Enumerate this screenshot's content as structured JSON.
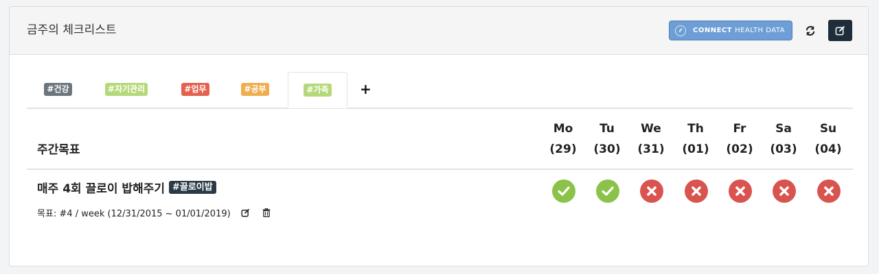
{
  "header": {
    "title": "금주의 체크리스트",
    "connect_bold": "CONNECT",
    "connect_rest": "HEALTH DATA"
  },
  "tabs": [
    {
      "label": "#건강",
      "color": "#6c757d"
    },
    {
      "label": "#자기관리",
      "color": "#b5d97a"
    },
    {
      "label": "#업무",
      "color": "#e4604f"
    },
    {
      "label": "#공부",
      "color": "#f0ad4e"
    },
    {
      "label": "#가족",
      "color": "#b5d97a",
      "active": true
    }
  ],
  "add_tab_label": "+",
  "table": {
    "goal_header": "주간목표",
    "days": [
      {
        "name": "Mo",
        "date": "(29)"
      },
      {
        "name": "Tu",
        "date": "(30)"
      },
      {
        "name": "We",
        "date": "(31)"
      },
      {
        "name": "Th",
        "date": "(01)"
      },
      {
        "name": "Fr",
        "date": "(02)"
      },
      {
        "name": "Sa",
        "date": "(03)"
      },
      {
        "name": "Su",
        "date": "(04)"
      }
    ]
  },
  "goal": {
    "title": "매주 4회 끌로이 밥해주기",
    "tag": "#끌로이밥",
    "target": "목표: #4 / week (12/31/2015 ~ 01/01/2019)",
    "statuses": [
      "done",
      "done",
      "miss",
      "miss",
      "miss",
      "miss",
      "miss"
    ]
  },
  "colors": {
    "done": "#8bc34a",
    "miss": "#d9534f",
    "connect": "#6d9ed6",
    "edit": "#1f2c3a"
  }
}
